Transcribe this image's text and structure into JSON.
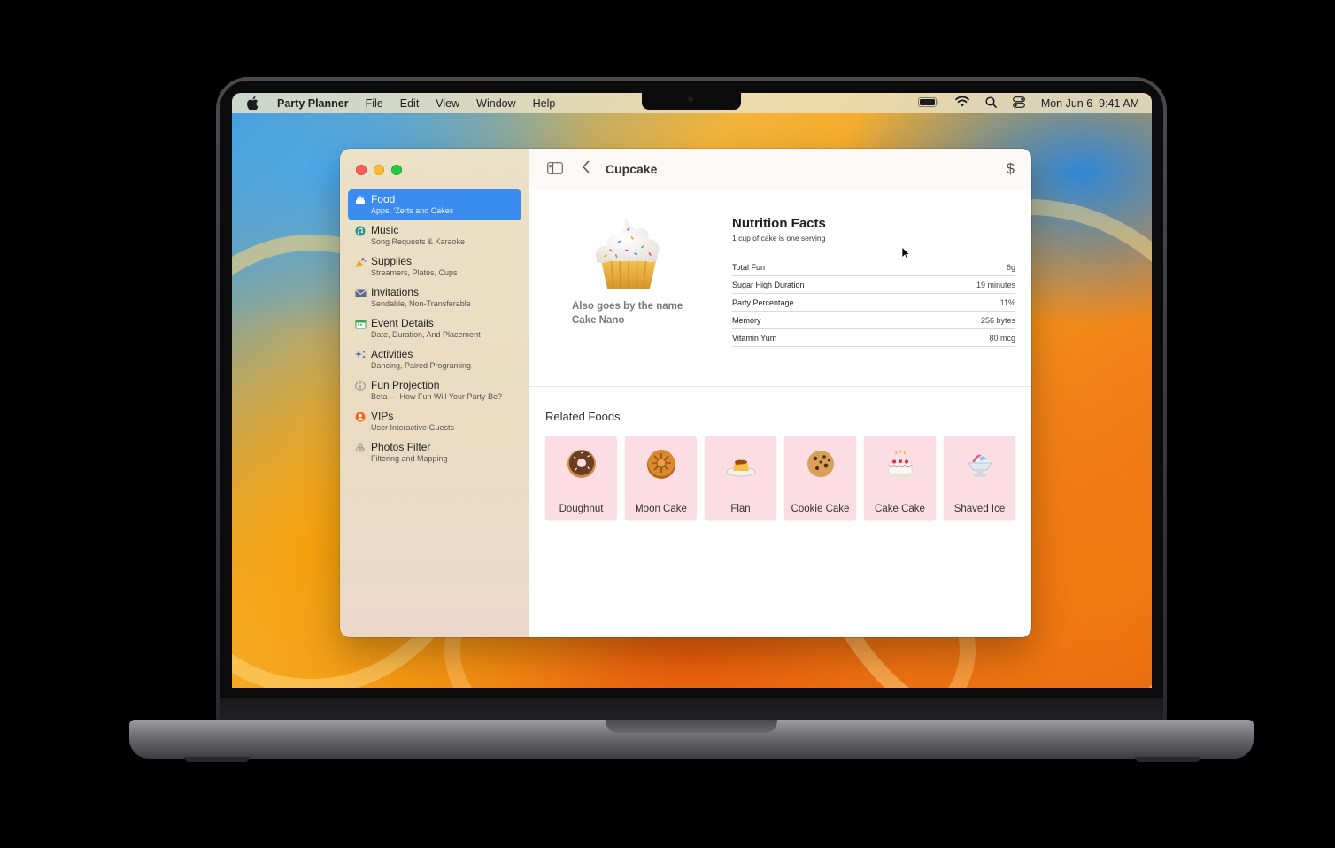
{
  "menubar": {
    "app_name": "Party Planner",
    "items": [
      "File",
      "Edit",
      "View",
      "Window",
      "Help"
    ],
    "clock": "Mon Jun 6  9:41 AM",
    "icons": [
      "apple-icon",
      "battery-icon",
      "wifi-icon",
      "search-icon",
      "control-center-icon"
    ]
  },
  "sidebar": {
    "items": [
      {
        "title": "Food",
        "subtitle": "Apps, 'Zerts and Cakes",
        "icon": "cake-icon",
        "selected": true
      },
      {
        "title": "Music",
        "subtitle": "Song Requests & Karaoke",
        "icon": "music-icon"
      },
      {
        "title": "Supplies",
        "subtitle": "Streamers, Plates, Cups",
        "icon": "party-popper-icon"
      },
      {
        "title": "Invitations",
        "subtitle": "Sendable, Non-Transferable",
        "icon": "envelope-icon"
      },
      {
        "title": "Event Details",
        "subtitle": "Date, Duration, And Placement",
        "icon": "calendar-icon"
      },
      {
        "title": "Activities",
        "subtitle": "Dancing, Paired Programing",
        "icon": "sparkles-icon"
      },
      {
        "title": "Fun Projection",
        "subtitle": "Beta — How Fun Will Your Party Be?",
        "icon": "info-icon"
      },
      {
        "title": "VIPs",
        "subtitle": "User Interactive Guests",
        "icon": "person-icon"
      },
      {
        "title": "Photos Filter",
        "subtitle": "Filtering and Mapping",
        "icon": "photo-filter-icon"
      }
    ]
  },
  "toolbar": {
    "title": "Cupcake",
    "back_icon": "chevron-left-icon",
    "sidebar_icon": "sidebar-toggle-icon",
    "dollar_symbol": "$"
  },
  "detail": {
    "caption_line1": "Also goes by the name",
    "caption_line2": "Cake Nano"
  },
  "nutrition": {
    "title": "Nutrition Facts",
    "serving": "1 cup of cake is one serving",
    "rows": [
      {
        "label": "Total Fun",
        "value": "6g"
      },
      {
        "label": "Sugar High Duration",
        "value": "19 minutes"
      },
      {
        "label": "Party Percentage",
        "value": "11%"
      },
      {
        "label": "Memory",
        "value": "256 bytes"
      },
      {
        "label": "Vitamin Yum",
        "value": "80 mcg"
      }
    ]
  },
  "related": {
    "title": "Related Foods",
    "items": [
      {
        "label": "Doughnut",
        "icon": "doughnut-icon"
      },
      {
        "label": "Moon Cake",
        "icon": "moon-cake-icon"
      },
      {
        "label": "Flan",
        "icon": "flan-icon"
      },
      {
        "label": "Cookie Cake",
        "icon": "cookie-icon"
      },
      {
        "label": "Cake Cake",
        "icon": "birthday-cake-icon"
      },
      {
        "label": "Shaved Ice",
        "icon": "shaved-ice-icon"
      }
    ]
  },
  "colors": {
    "accent": "#3b8cf0",
    "card_bg": "#fbdde3",
    "sidebar_bg": "#ebe1c7"
  }
}
